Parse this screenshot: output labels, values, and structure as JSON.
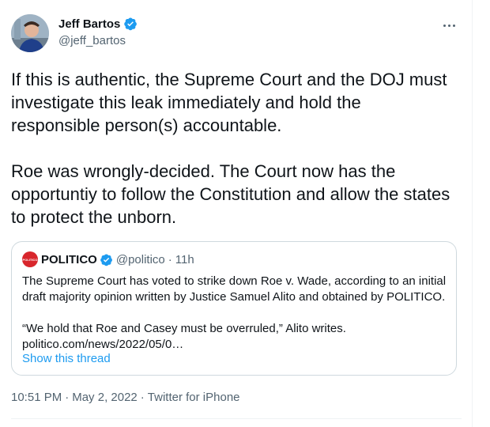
{
  "author": {
    "name": "Jeff Bartos",
    "handle": "@jeff_bartos",
    "verified_icon": "verified-badge-icon",
    "accent": "#1d9bf0"
  },
  "more_icon": "more-horizontal-icon",
  "tweet": {
    "paragraphs": [
      "If this is authentic, the Supreme Court and the DOJ must investigate this leak immediately and hold the responsible person(s) accountable.",
      "Roe was wrongly-decided. The Court now has the opportuntiy to follow the Constitution and allow the states to protect the unborn."
    ],
    "time": "10:51 PM",
    "date": "May 2, 2022",
    "source": "Twitter for iPhone",
    "separator": "·"
  },
  "quote": {
    "logo_text": "POLITICO",
    "name": "POLITICO",
    "handle": "@politico",
    "separator": "·",
    "time": "11h",
    "paragraphs": [
      "The Supreme Court has voted to strike down Roe v. Wade, according to an initial draft majority opinion written by Justice Samuel Alito and obtained by POLITICO.",
      "“We hold that Roe and Casey must be overruled,” Alito writes. politico.com/news/2022/05/0…"
    ],
    "show_thread": "Show this thread",
    "logo_color": "#d8262c"
  }
}
